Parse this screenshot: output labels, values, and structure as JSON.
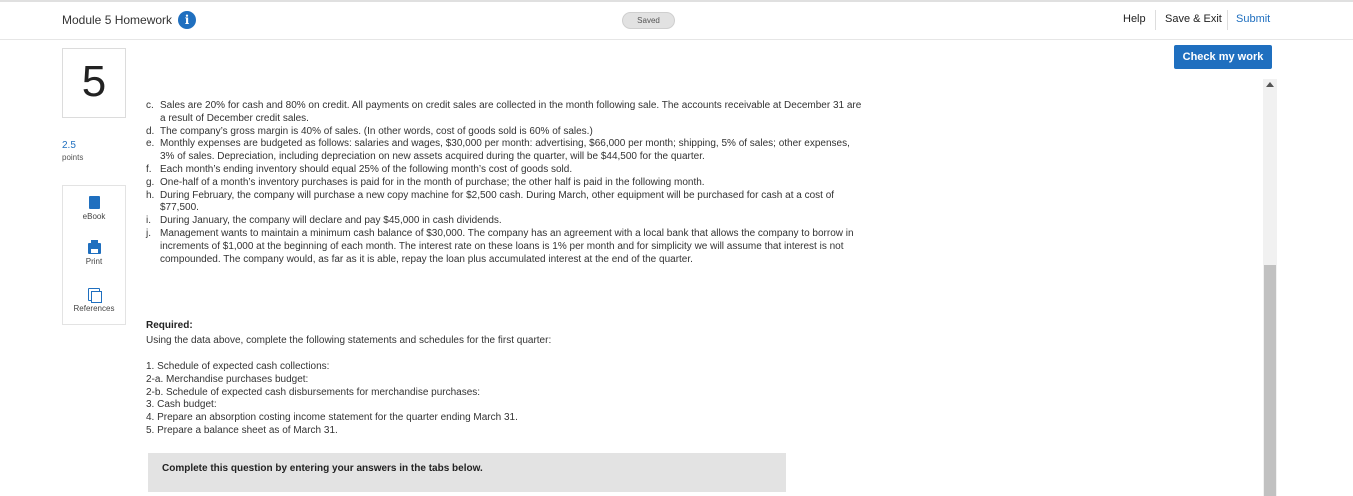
{
  "header": {
    "title": "Module 5 Homework",
    "info_icon": "i",
    "saved": "Saved",
    "help": "Help",
    "save_exit": "Save & Exit",
    "submit": "Submit"
  },
  "check_button": "Check my work",
  "question": {
    "number": "5",
    "points_value": "2.5",
    "points_label": "points"
  },
  "tools": [
    {
      "label": "eBook",
      "icon": "book-icon"
    },
    {
      "label": "Print",
      "icon": "printer-icon"
    },
    {
      "label": "References",
      "icon": "references-icon"
    }
  ],
  "items": [
    {
      "label": "c.",
      "text": "Sales are 20% for cash and 80% on credit. All payments on credit sales are collected in the month following sale. The accounts receivable at December 31 are a result of December credit sales."
    },
    {
      "label": "d.",
      "text": "The company’s gross margin is 40% of sales. (In other words, cost of goods sold is 60% of sales.)"
    },
    {
      "label": "e.",
      "text": "Monthly expenses are budgeted as follows: salaries and wages, $30,000 per month: advertising, $66,000 per month; shipping, 5% of sales; other expenses, 3% of sales. Depreciation, including depreciation on new assets acquired during the quarter, will be $44,500 for the quarter."
    },
    {
      "label": "f.",
      "text": "Each month’s ending inventory should equal 25% of the following month’s cost of goods sold."
    },
    {
      "label": "g.",
      "text": "One-half of a month’s inventory purchases is paid for in the month of purchase; the other half is paid in the following month."
    },
    {
      "label": "h.",
      "text": "During February, the company will purchase a new copy machine for $2,500 cash. During March, other equipment will be purchased for cash at a cost of $77,500."
    },
    {
      "label": "i.",
      "text": "During January, the company will declare and pay $45,000 in cash dividends."
    },
    {
      "label": "j.",
      "text": "Management wants to maintain a minimum cash balance of $30,000. The company has an agreement with a local bank that allows the company to borrow in increments of $1,000 at the beginning of each month. The interest rate on these loans is 1% per month and for simplicity we will assume that interest is not compounded. The company would, as far as it is able, repay the loan plus accumulated interest at the end of the quarter."
    }
  ],
  "required": {
    "heading": "Required:",
    "intro": "Using the data above, complete the following statements and schedules for the first quarter:",
    "tasks": [
      "1. Schedule of expected cash collections:",
      "2-a. Merchandise purchases budget:",
      "2-b. Schedule of expected cash disbursements for merchandise purchases:",
      "3. Cash budget:",
      "4. Prepare an absorption costing income statement for the quarter ending March 31.",
      "5. Prepare a balance sheet as of March 31."
    ]
  },
  "complete_box": "Complete this question by entering your answers in the tabs below."
}
